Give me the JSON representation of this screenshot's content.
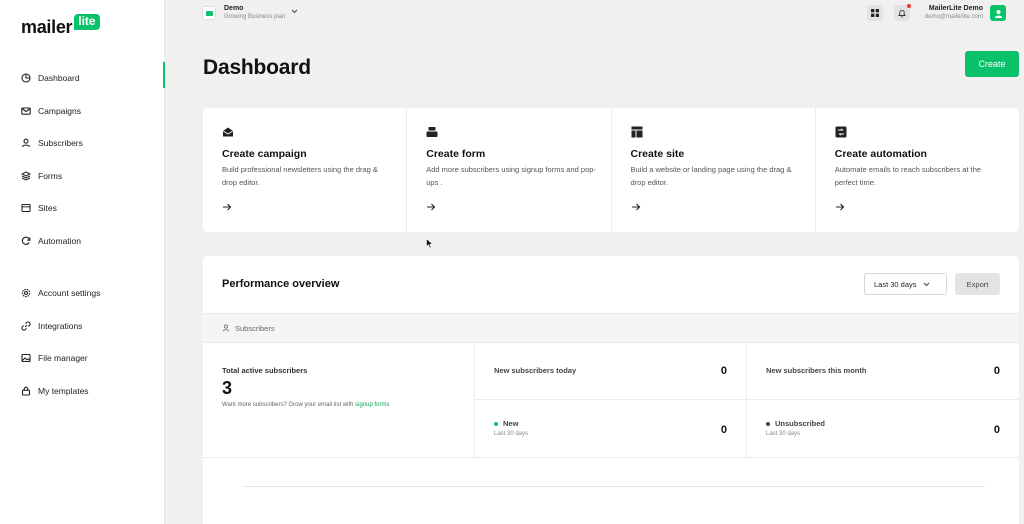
{
  "brand": {
    "word": "mailer",
    "bubble": "lite",
    "accent": "#09c269"
  },
  "sidebar": {
    "items": [
      {
        "label": "Dashboard",
        "icon": "dashboard-icon",
        "active": true
      },
      {
        "label": "Campaigns",
        "icon": "mail-icon"
      },
      {
        "label": "Subscribers",
        "icon": "user-icon"
      },
      {
        "label": "Forms",
        "icon": "layers-icon"
      },
      {
        "label": "Sites",
        "icon": "browser-icon"
      },
      {
        "label": "Automation",
        "icon": "refresh-icon"
      }
    ],
    "secondary": [
      {
        "label": "Account settings",
        "icon": "gear-icon"
      },
      {
        "label": "Integrations",
        "icon": "link-icon"
      },
      {
        "label": "File manager",
        "icon": "image-icon"
      },
      {
        "label": "My templates",
        "icon": "lock-icon"
      }
    ]
  },
  "topbar": {
    "account_name": "Demo",
    "account_plan": "Growing Business plan",
    "user_name": "MailerLite Demo",
    "user_email": "demo@mailerlite.com"
  },
  "page": {
    "title": "Dashboard",
    "create_label": "Create"
  },
  "cards": [
    {
      "title": "Create campaign",
      "desc": "Build professional newsletters using the drag & drop editor.",
      "icon": "envelope-icon"
    },
    {
      "title": "Create form",
      "desc": "Add more subscribers using signup forms and pop-ups .",
      "icon": "form-icon"
    },
    {
      "title": "Create site",
      "desc": "Build a website or landing page using the drag & drop editor.",
      "icon": "site-layout-icon"
    },
    {
      "title": "Create automation",
      "desc": "Automate emails to reach subscribers at the perfect time.",
      "icon": "automation-icon"
    }
  ],
  "performance": {
    "title": "Performance overview",
    "range": "Last 30 days",
    "export_label": "Export",
    "section": "Subscribers",
    "total_label": "Total active subscribers",
    "total_value": "3",
    "hint_prefix": "Want more subscribers? Grow your email list with",
    "hint_link": "signup forms",
    "today_label": "New subscribers today",
    "today_value": "0",
    "month_label": "New subscribers this month",
    "month_value": "0",
    "new_label": "New",
    "new_sub": "Last 30 days",
    "new_value": "0",
    "new_color": "#09c269",
    "unsub_label": "Unsubscribed",
    "unsub_sub": "Last 30 days",
    "unsub_value": "0",
    "unsub_color": "#444444"
  }
}
